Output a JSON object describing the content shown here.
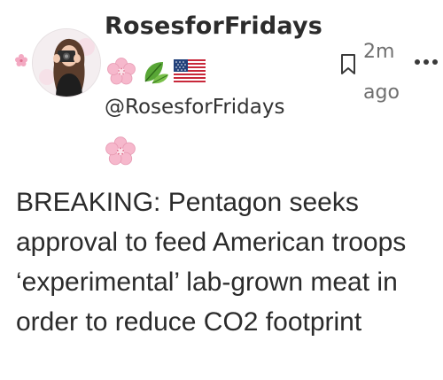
{
  "post": {
    "display_name": "RosesforFridays",
    "handle": "@RosesforFridays",
    "timestamp": "2m ago",
    "profile_emojis": [
      "cherry-blossom",
      "leaves",
      "us-flag"
    ],
    "bio_emoji": "cherry-blossom",
    "text": "BREAKING: Pentagon seeks approval to feed American troops ‘experimental’ lab-grown meat in order to reduce CO2 footprint",
    "icons": {
      "bookmark": "bookmark-icon",
      "more": "more-dots-icon"
    }
  },
  "colors": {
    "text": "#2b2b2b",
    "muted": "#6f6f6f",
    "blossom": "#f4b6cb",
    "leaf": "#4f9a2f"
  }
}
